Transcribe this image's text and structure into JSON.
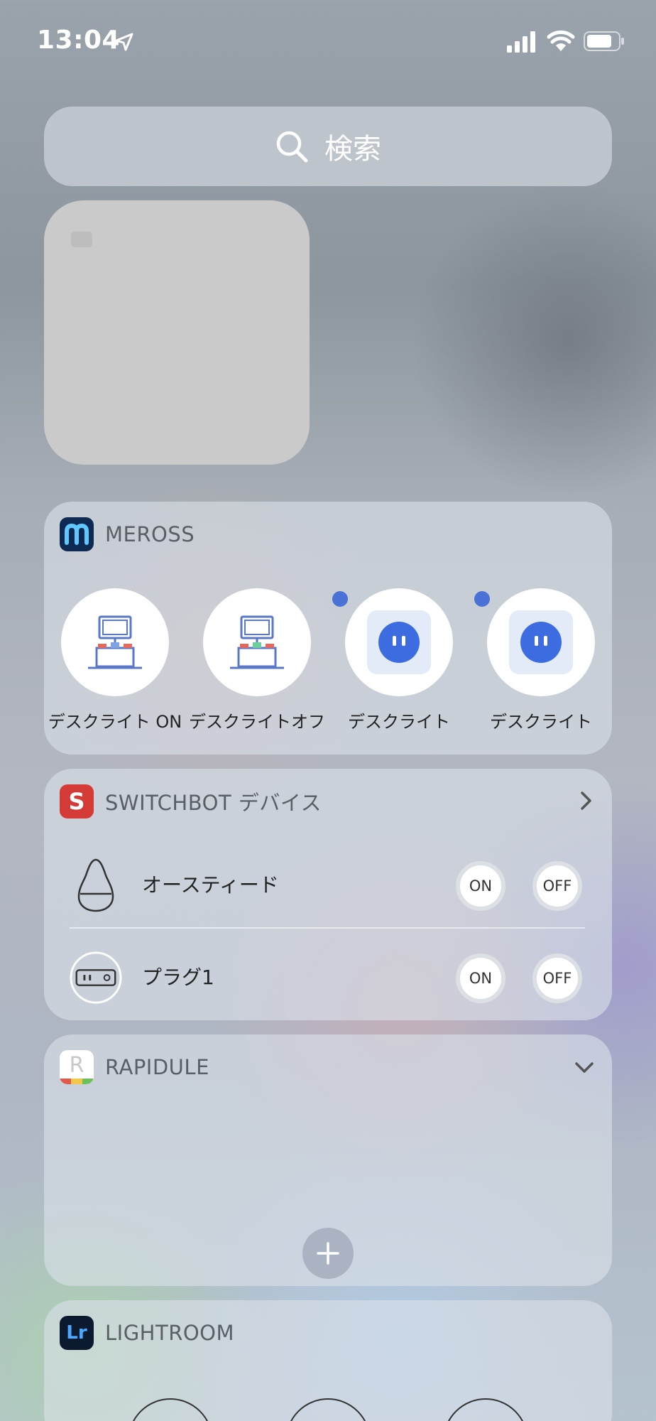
{
  "status_bar": {
    "time": "13:04"
  },
  "search": {
    "placeholder": "検索"
  },
  "meross": {
    "title": "MEROSS",
    "items": [
      {
        "label": "デスクライト ON",
        "icon": "desk-scene-icon"
      },
      {
        "label": "デスクライトオフ",
        "icon": "desk-scene-icon"
      },
      {
        "label": "デスクライト",
        "icon": "smart-plug-icon"
      },
      {
        "label": "デスクライト",
        "icon": "smart-plug-icon"
      }
    ]
  },
  "switchbot": {
    "title": "SWITCHBOT デバイス",
    "devices": [
      {
        "name": "オースティード",
        "icon": "bulb-icon",
        "on_label": "ON",
        "off_label": "OFF"
      },
      {
        "name": "プラグ1",
        "icon": "plug-icon",
        "on_label": "ON",
        "off_label": "OFF"
      }
    ]
  },
  "rapidule": {
    "title": "RAPIDULE",
    "icon_letter": "R"
  },
  "lightroom": {
    "title": "LIGHTROOM",
    "icon_text": "Lr"
  },
  "colors": {
    "accent_blue": "#3c6ce0",
    "switchbot_red": "#d43b36",
    "meross_navy": "#0f2a52"
  }
}
